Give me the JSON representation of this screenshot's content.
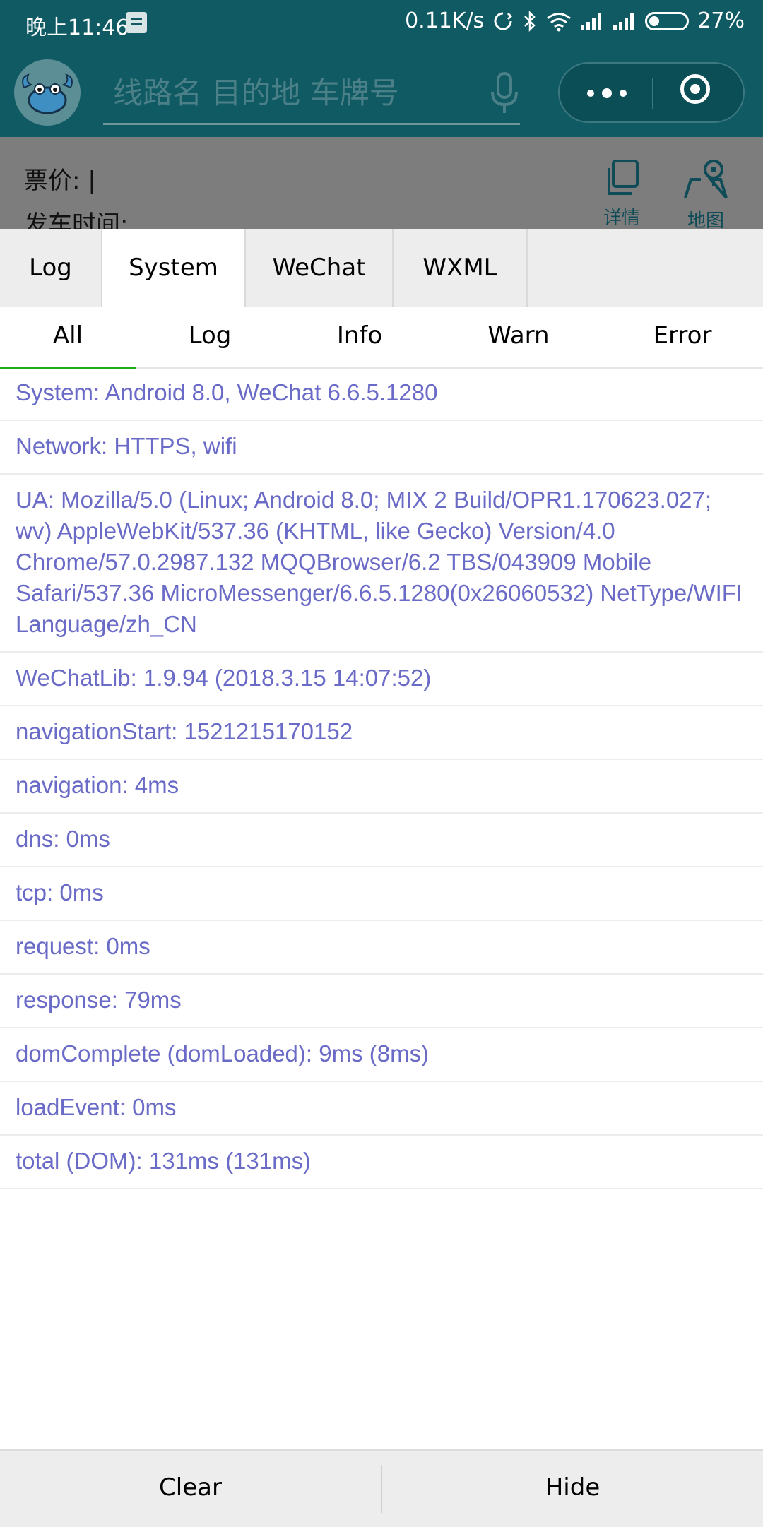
{
  "status_bar": {
    "time": "晚上11:46",
    "network_speed": "0.11K/s",
    "battery_percent": "27%",
    "icons": [
      "notification-icon",
      "sync-icon",
      "bluetooth-icon",
      "wifi-icon",
      "signal-icon",
      "signal-icon",
      "battery-icon"
    ]
  },
  "navbar": {
    "search_placeholder": "线路名 目的地 车牌号",
    "avatar_icon": "crab-icon",
    "mic_icon": "microphone-icon",
    "more_icon": "more-dots-icon",
    "close_icon": "target-close-icon"
  },
  "page_behind": {
    "fare_label": "票价: |",
    "depart_label": "发车时间:",
    "actions": [
      {
        "label": "详情",
        "icon": "copy-icon"
      },
      {
        "label": "地图",
        "icon": "map-pin-icon"
      }
    ]
  },
  "console": {
    "tabs": [
      "Log",
      "System",
      "WeChat",
      "WXML"
    ],
    "active_tab": "System",
    "subtabs": [
      "All",
      "Log",
      "Info",
      "Warn",
      "Error"
    ],
    "active_subtab": "All",
    "entries": [
      "System: Android 8.0, WeChat 6.6.5.1280",
      "Network: HTTPS, wifi",
      "UA: Mozilla/5.0 (Linux; Android 8.0; MIX 2 Build/OPR1.170623.027; wv) AppleWebKit/537.36 (KHTML, like Gecko) Version/4.0 Chrome/57.0.2987.132 MQQBrowser/6.2 TBS/043909 Mobile Safari/537.36 MicroMessenger/6.6.5.1280(0x26060532) NetType/WIFI Language/zh_CN",
      "WeChatLib: 1.9.94 (2018.3.15 14:07:52)",
      "navigationStart: 1521215170152",
      "navigation: 4ms",
      "dns: 0ms",
      "tcp: 0ms",
      "request: 0ms",
      "response: 79ms",
      "domComplete (domLoaded): 9ms (8ms)",
      "loadEvent: 0ms",
      "total (DOM): 131ms (131ms)"
    ],
    "footer": {
      "clear_label": "Clear",
      "hide_label": "Hide"
    }
  },
  "colors": {
    "header_bg": "#0f5a63",
    "log_text": "#6a6ac7",
    "active_underline": "#1aad19"
  }
}
